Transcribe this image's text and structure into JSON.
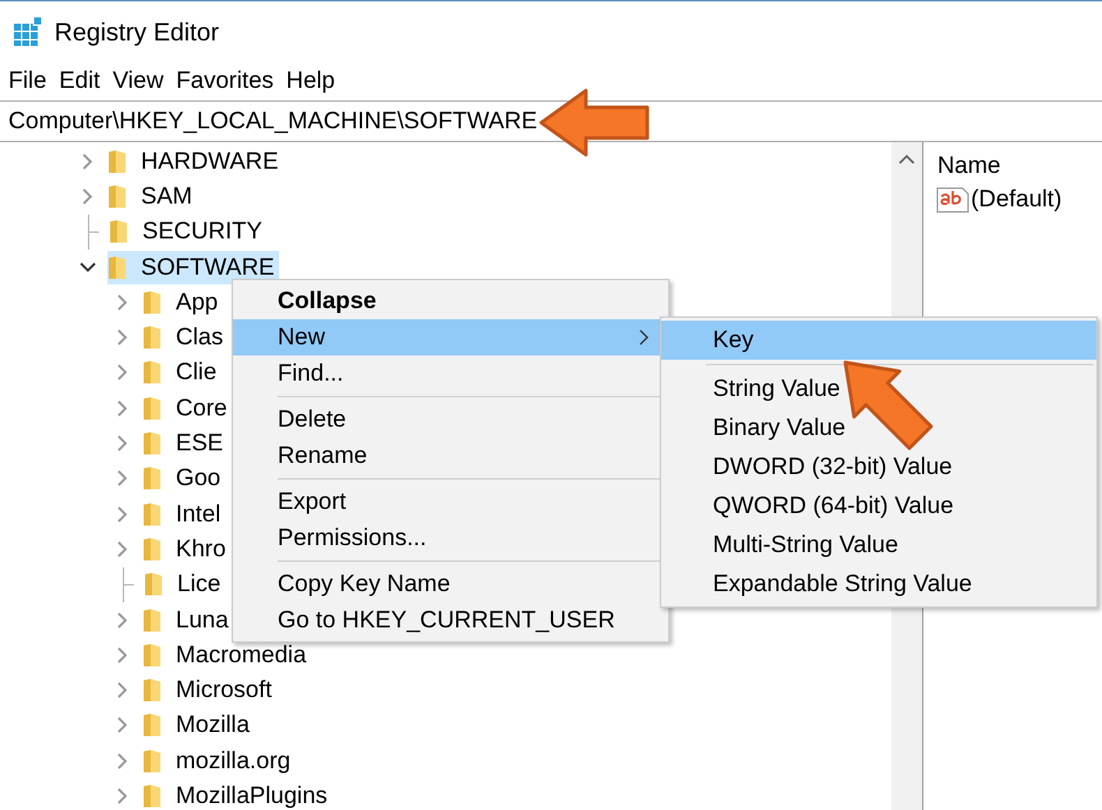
{
  "window": {
    "title": "Registry Editor"
  },
  "menu_bar": [
    "File",
    "Edit",
    "View",
    "Favorites",
    "Help"
  ],
  "address_bar": {
    "value": "Computer\\HKEY_LOCAL_MACHINE\\SOFTWARE"
  },
  "tree": [
    {
      "label": "HARDWARE",
      "leaf": false,
      "expanded": false,
      "selected": false
    },
    {
      "label": "SAM",
      "leaf": false,
      "expanded": false,
      "selected": false
    },
    {
      "label": "SECURITY",
      "leaf": true,
      "selected": false
    },
    {
      "label": "SOFTWARE",
      "leaf": false,
      "expanded": true,
      "selected": true,
      "children": [
        {
          "label": "App",
          "leaf": false,
          "expanded": false,
          "selected": false
        },
        {
          "label": "Clas",
          "leaf": false,
          "expanded": false,
          "selected": false
        },
        {
          "label": "Clie",
          "leaf": false,
          "expanded": false,
          "selected": false
        },
        {
          "label": "Core",
          "leaf": false,
          "expanded": false,
          "selected": false
        },
        {
          "label": "ESE",
          "leaf": false,
          "expanded": false,
          "selected": false
        },
        {
          "label": "Goo",
          "leaf": false,
          "expanded": false,
          "selected": false
        },
        {
          "label": "Intel",
          "leaf": false,
          "expanded": false,
          "selected": false
        },
        {
          "label": "Khro",
          "leaf": false,
          "expanded": false,
          "selected": false
        },
        {
          "label": "Lice",
          "leaf": true,
          "selected": false
        },
        {
          "label": "Luna",
          "leaf": false,
          "expanded": false,
          "selected": false
        },
        {
          "label": "Macromedia",
          "leaf": false,
          "expanded": false,
          "selected": false
        },
        {
          "label": "Microsoft",
          "leaf": false,
          "expanded": false,
          "selected": false
        },
        {
          "label": "Mozilla",
          "leaf": false,
          "expanded": false,
          "selected": false
        },
        {
          "label": "mozilla.org",
          "leaf": false,
          "expanded": false,
          "selected": false
        },
        {
          "label": "MozillaPlugins",
          "leaf": false,
          "expanded": false,
          "selected": false
        }
      ]
    }
  ],
  "values_pane": {
    "columns": [
      "Name"
    ],
    "rows": [
      {
        "name": "(Default)",
        "kind": "string"
      }
    ]
  },
  "context_menu": {
    "items": [
      {
        "kind": "item",
        "label": "Collapse",
        "default": true,
        "selected": false,
        "has_submenu": false
      },
      {
        "kind": "item",
        "label": "New",
        "default": false,
        "selected": true,
        "has_submenu": true
      },
      {
        "kind": "item",
        "label": "Find...",
        "default": false,
        "selected": false,
        "has_submenu": false
      },
      {
        "kind": "separator"
      },
      {
        "kind": "item",
        "label": "Delete",
        "default": false,
        "selected": false,
        "has_submenu": false
      },
      {
        "kind": "item",
        "label": "Rename",
        "default": false,
        "selected": false,
        "has_submenu": false
      },
      {
        "kind": "separator"
      },
      {
        "kind": "item",
        "label": "Export",
        "default": false,
        "selected": false,
        "has_submenu": false
      },
      {
        "kind": "item",
        "label": "Permissions...",
        "default": false,
        "selected": false,
        "has_submenu": false
      },
      {
        "kind": "separator"
      },
      {
        "kind": "item",
        "label": "Copy Key Name",
        "default": false,
        "selected": false,
        "has_submenu": false
      },
      {
        "kind": "item",
        "label": "Go to HKEY_CURRENT_USER",
        "default": false,
        "selected": false,
        "has_submenu": false
      }
    ]
  },
  "submenu": {
    "items": [
      {
        "kind": "item",
        "label": "Key",
        "selected": true
      },
      {
        "kind": "separator"
      },
      {
        "kind": "item",
        "label": "String Value",
        "selected": false
      },
      {
        "kind": "item",
        "label": "Binary Value",
        "selected": false
      },
      {
        "kind": "item",
        "label": "DWORD (32-bit) Value",
        "selected": false
      },
      {
        "kind": "item",
        "label": "QWORD (64-bit) Value",
        "selected": false
      },
      {
        "kind": "item",
        "label": "Multi-String Value",
        "selected": false
      },
      {
        "kind": "item",
        "label": "Expandable String Value",
        "selected": false
      }
    ]
  },
  "annotations": [
    {
      "kind": "leftarrow"
    },
    {
      "kind": "diagonalarrow"
    }
  ]
}
